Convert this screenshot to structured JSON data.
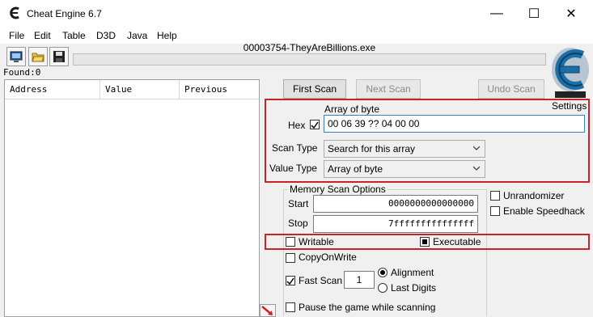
{
  "window": {
    "title": "Cheat Engine 6.7",
    "minimize": "—",
    "maximize": "☐",
    "close": "✕"
  },
  "menu": [
    "File",
    "Edit",
    "Table",
    "D3D",
    "Java",
    "Help"
  ],
  "process": "00003754-TheyAreBillions.exe",
  "found": "Found:0",
  "results_columns": [
    "Address",
    "Value",
    "Previous"
  ],
  "buttons": {
    "first_scan": "First Scan",
    "next_scan": "Next Scan",
    "undo_scan": "Undo Scan"
  },
  "settings_label": "Settings",
  "value": {
    "type_label": "Array of byte",
    "hex_label": "Hex",
    "hex_checked": true,
    "input": "00 06 39 ?? 04 00 00"
  },
  "scan_type": {
    "label": "Scan Type",
    "selected": "Search for this array"
  },
  "value_type": {
    "label": "Value Type",
    "selected": "Array of byte"
  },
  "memory": {
    "group_label": "Memory Scan Options",
    "start_label": "Start",
    "start": "0000000000000000",
    "stop_label": "Stop",
    "stop": "7fffffffffffffff",
    "writable": "Writable",
    "writable_checked": false,
    "executable": "Executable",
    "executable_checked": true,
    "copyonwrite": "CopyOnWrite",
    "copyonwrite_checked": false,
    "fastscan": "Fast Scan",
    "fastscan_checked": true,
    "fastscan_value": "1",
    "alignment": "Alignment",
    "last_digits": "Last Digits",
    "alignment_selected": true,
    "pause": "Pause the game while scanning"
  },
  "unrandomizer": "Unrandomizer",
  "speedhack": "Enable Speedhack",
  "colors": {
    "highlight": "#c6242b",
    "logo": "#1a6fa8"
  }
}
